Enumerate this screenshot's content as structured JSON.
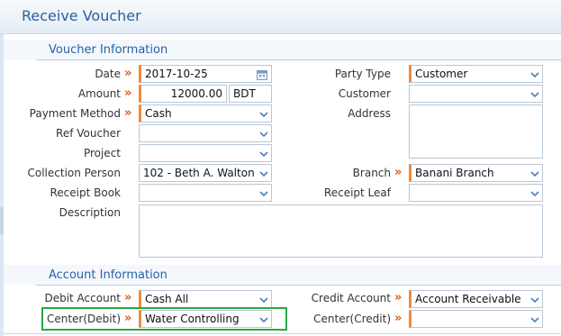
{
  "page": {
    "title": "Receive Voucher"
  },
  "sections": {
    "voucher_info": "Voucher Information",
    "account_info": "Account Information"
  },
  "fields": {
    "date": {
      "label": "Date",
      "value": "2017-10-25"
    },
    "amount": {
      "label": "Amount",
      "value": "12000.00",
      "currency": "BDT"
    },
    "payment_method": {
      "label": "Payment Method",
      "value": "Cash"
    },
    "ref_voucher": {
      "label": "Ref Voucher",
      "value": ""
    },
    "project": {
      "label": "Project",
      "value": ""
    },
    "collection_person": {
      "label": "Collection Person",
      "value": "102 - Beth A. Walton"
    },
    "receipt_book": {
      "label": "Receipt Book",
      "value": ""
    },
    "description": {
      "label": "Description",
      "value": ""
    },
    "party_type": {
      "label": "Party Type",
      "value": "Customer"
    },
    "customer": {
      "label": "Customer",
      "value": ""
    },
    "address": {
      "label": "Address",
      "value": ""
    },
    "branch": {
      "label": "Branch",
      "value": "Banani Branch"
    },
    "receipt_leaf": {
      "label": "Receipt Leaf",
      "value": ""
    },
    "debit_account": {
      "label": "Debit Account",
      "value": "Cash All"
    },
    "center_debit": {
      "label": "Center(Debit)",
      "value": "Water Controlling"
    },
    "credit_account": {
      "label": "Credit Account",
      "value": "Account Receivable"
    },
    "center_credit": {
      "label": "Center(Credit)",
      "value": ""
    }
  },
  "required_marker": "»",
  "colors": {
    "title": "#2c5f9a",
    "section": "#2563a6",
    "required": "#e05a1a",
    "required_border": "#f08a3c",
    "highlight": "#28a745"
  },
  "icons": {
    "dropdown": "chevron-down-icon",
    "calendar": "calendar-icon"
  }
}
